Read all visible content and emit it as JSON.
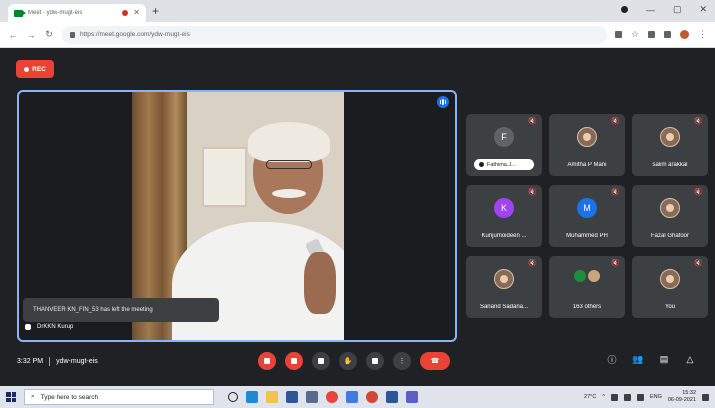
{
  "browser": {
    "tab_title": "Meet - ydw-mugt-eis",
    "url": "https://meet.google.com/ydw-mugt-eis",
    "new_tab_symbol": "+"
  },
  "meeting": {
    "rec_label": "REC",
    "toast": "THANVEER KN_FIN_53 has left the meeting",
    "main_speaker": "DrKKN Kurup",
    "time": "3:32 PM",
    "code": "ydw-mugt-eis"
  },
  "participants": [
    {
      "name": "Fathima.J...",
      "initial": "F",
      "kind": "initial",
      "color": "#5f6368",
      "pill": true
    },
    {
      "name": "Amitha P Mani",
      "kind": "photo"
    },
    {
      "name": "salim arakkal",
      "kind": "photo"
    },
    {
      "name": "Kunjumoideen ...",
      "initial": "K",
      "kind": "initial",
      "color": "#a142f4"
    },
    {
      "name": "Muhammed PH",
      "initial": "M",
      "kind": "initial",
      "color": "#1a73e8"
    },
    {
      "name": "Fazal Ghafoor",
      "kind": "photo"
    },
    {
      "name": "Sanand Sadana...",
      "kind": "photo"
    },
    {
      "name": "163 others",
      "kind": "group"
    },
    {
      "name": "You",
      "kind": "photo"
    }
  ],
  "taskbar": {
    "search_placeholder": "Type here to search",
    "temperature": "27°C",
    "lang": "ENG",
    "clock_time": "15:32",
    "clock_date": "06-09-2021"
  },
  "colors": {
    "accent_red": "#ea4335",
    "speaker_border": "#8ab4f8",
    "meet_bg": "#202124"
  }
}
